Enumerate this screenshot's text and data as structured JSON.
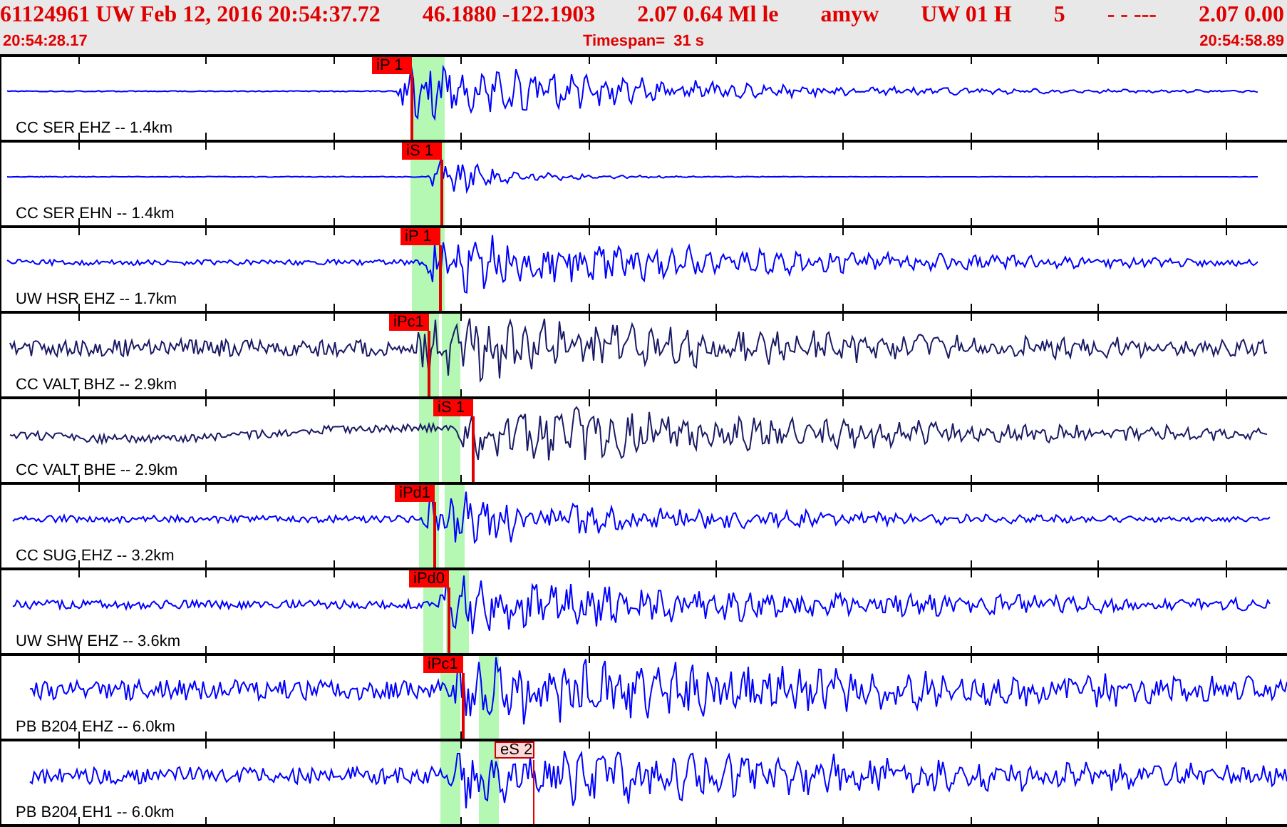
{
  "header": {
    "fields": [
      "61124961 UW Feb 12, 2016 20:54:37.72",
      "46.1880 -122.1903",
      "2.07 0.64 Ml le",
      "amyw",
      "UW 01 H",
      "5",
      "- - ---",
      "2.07 0.00"
    ],
    "start_time": "20:54:28.17",
    "timespan": "Timespan=  31 s",
    "end_time": "20:54:58.89"
  },
  "traces": [
    {
      "label": "CC SER EHZ -- 1.4km",
      "color": "#0000ff",
      "picks": [
        {
          "label": "iP 1",
          "kind": "filled"
        }
      ]
    },
    {
      "label": "CC SER EHN -- 1.4km",
      "color": "#0000ff",
      "picks": [
        {
          "label": "iS 1",
          "kind": "filled"
        }
      ]
    },
    {
      "label": "UW HSR EHZ -- 1.7km",
      "color": "#0000ff",
      "picks": [
        {
          "label": "iP 1",
          "kind": "filled"
        }
      ]
    },
    {
      "label": "CC VALT BHZ -- 2.9km",
      "color": "#1a1a66",
      "picks": [
        {
          "label": "iPc1",
          "kind": "filled"
        }
      ]
    },
    {
      "label": "CC VALT BHE -- 2.9km",
      "color": "#1a1a66",
      "picks": [
        {
          "label": "iS 1",
          "kind": "filled"
        }
      ]
    },
    {
      "label": "CC SUG EHZ -- 3.2km",
      "color": "#0000ff",
      "picks": [
        {
          "label": "iPd1",
          "kind": "filled"
        }
      ]
    },
    {
      "label": "UW SHW EHZ -- 3.6km",
      "color": "#0000ff",
      "picks": [
        {
          "label": "iPd0",
          "kind": "filled"
        }
      ]
    },
    {
      "label": "PB B204 EHZ -- 6.0km",
      "color": "#0000ff",
      "picks": [
        {
          "label": "iPc1",
          "kind": "filled"
        }
      ]
    },
    {
      "label": "PB B204 EH1 -- 6.0km",
      "color": "#0000ff",
      "picks": [
        {
          "label": "eS 2",
          "kind": "outlined"
        }
      ]
    }
  ]
}
